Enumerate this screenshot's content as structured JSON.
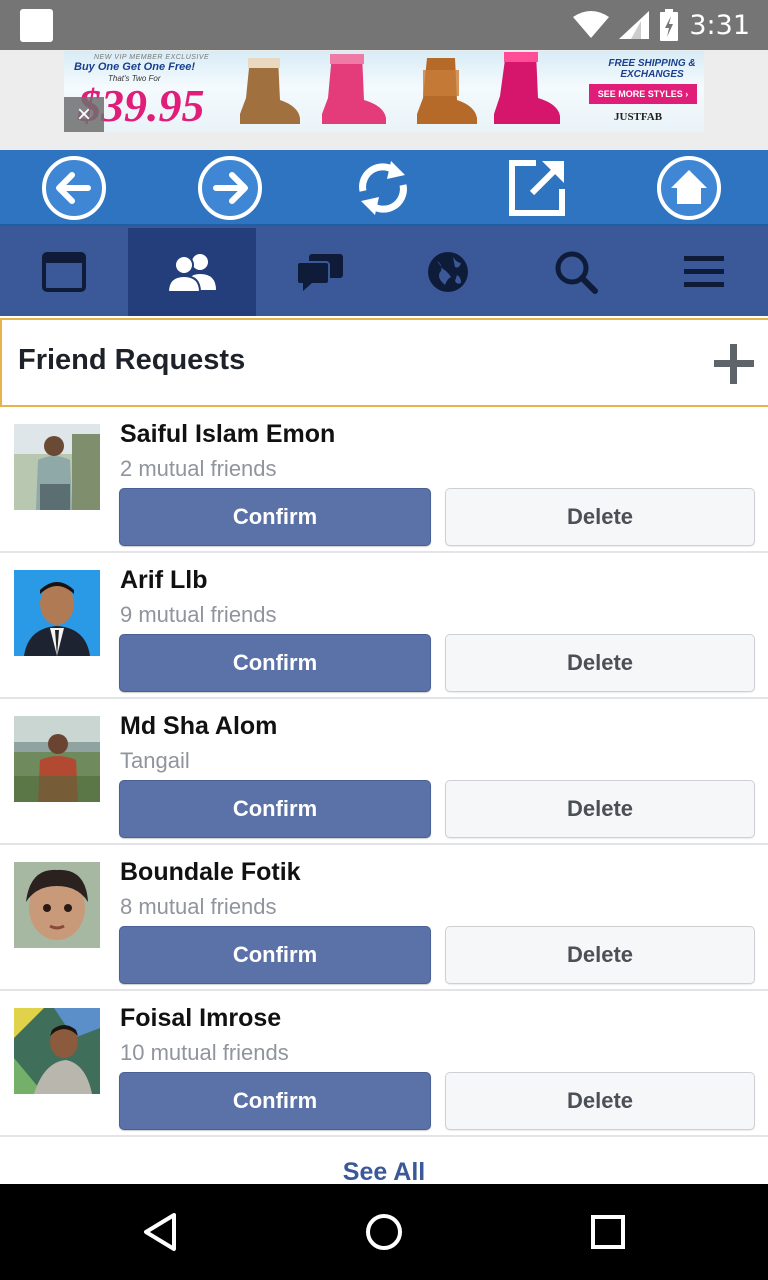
{
  "status_bar": {
    "time": "3:31",
    "icons": [
      "notification-square-icon",
      "wifi-icon",
      "cell-signal-icon",
      "battery-charging-icon"
    ]
  },
  "ad": {
    "small_line": "NEW VIP MEMBER EXCLUSIVE",
    "headline": "Buy One Get One Free!",
    "subline": "That's Two For",
    "price": "$39.95",
    "shipping": "FREE SHIPPING & EXCHANGES",
    "cta": "SEE MORE STYLES ›",
    "brand": "JUSTFAB",
    "close_label": "×"
  },
  "browser_toolbar": {
    "buttons": [
      "back-arrow-icon",
      "forward-arrow-icon",
      "refresh-icon",
      "open-external-icon",
      "home-icon"
    ],
    "accent": "#2e74c0"
  },
  "fb_nav": {
    "tabs": [
      "news-feed-icon",
      "friends-icon",
      "messages-icon",
      "notifications-globe-icon",
      "search-icon",
      "menu-icon"
    ],
    "active_tab": "friends-icon",
    "accent": "#3b5998"
  },
  "friend_requests": {
    "title": "Friend Requests",
    "add_label": "+",
    "confirm_label": "Confirm",
    "delete_label": "Delete",
    "items": [
      {
        "name": "Saiful Islam Emon",
        "subtitle": "2 mutual friends"
      },
      {
        "name": "Arif Llb",
        "subtitle": "9 mutual friends"
      },
      {
        "name": "Md Sha Alom",
        "subtitle": "Tangail"
      },
      {
        "name": "Boundale Fotik",
        "subtitle": "8 mutual friends"
      },
      {
        "name": "Foisal Imrose",
        "subtitle": "10 mutual friends"
      }
    ],
    "see_all": "See All"
  },
  "nav_bar": {
    "buttons": [
      "back-triangle-icon",
      "home-circle-icon",
      "recents-square-icon"
    ]
  }
}
